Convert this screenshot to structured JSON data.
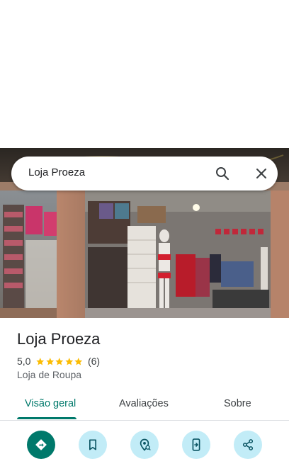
{
  "search": {
    "query": "Loja Proeza",
    "search_icon": "search-icon",
    "close_icon": "close-icon"
  },
  "place": {
    "name": "Loja Proeza",
    "rating": "5,0",
    "stars": 5,
    "review_count": "(6)",
    "category": "Loja de Roupa",
    "photo": "store-front-photo"
  },
  "tabs": [
    {
      "label": "Visão geral",
      "active": true
    },
    {
      "label": "Avaliações",
      "active": false
    },
    {
      "label": "Sobre",
      "active": false
    }
  ],
  "actions": [
    {
      "icon": "directions-icon"
    },
    {
      "icon": "bookmark-icon"
    },
    {
      "icon": "nearby-location-icon"
    },
    {
      "icon": "send-to-phone-icon"
    },
    {
      "icon": "share-icon"
    }
  ],
  "colors": {
    "accent": "#00796b",
    "action_button_bg": "#c2ecf7",
    "star": "#fbbc04"
  }
}
